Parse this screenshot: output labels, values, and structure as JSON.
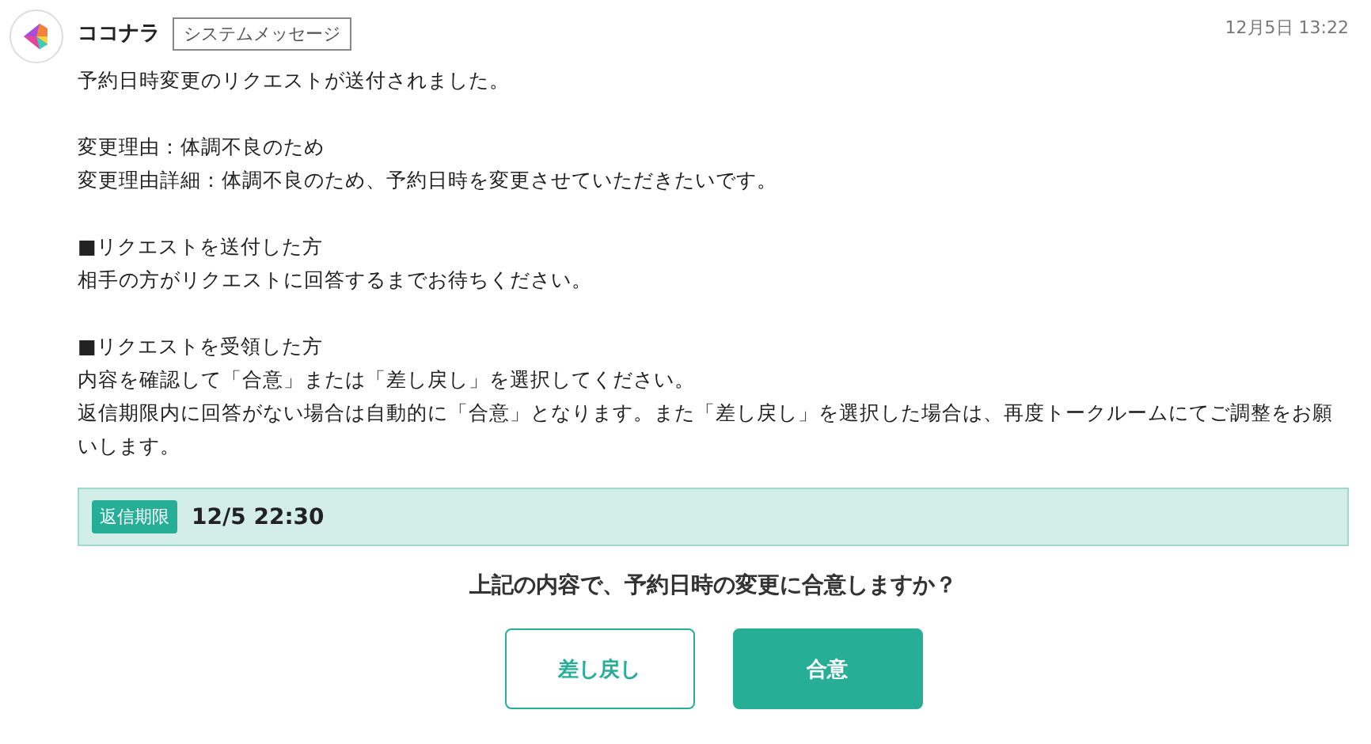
{
  "sender": {
    "name": "ココナラ",
    "tag": "システムメッセージ"
  },
  "timestamp": "12月5日 13:22",
  "paragraphs": [
    [
      "予約日時変更のリクエストが送付されました。"
    ],
    [
      "変更理由：体調不良のため",
      "変更理由詳細：体調不良のため、予約日時を変更させていただきたいです。"
    ],
    [
      "■リクエストを送付した方",
      "相手の方がリクエストに回答するまでお待ちください。"
    ],
    [
      "■リクエストを受領した方",
      "内容を確認して「合意」または「差し戻し」を選択してください。",
      "返信期限内に回答がない場合は自動的に「合意」となります。また「差し戻し」を選択した場合は、再度トークルームにてご調整をお願いします。"
    ]
  ],
  "deadline": {
    "label": "返信期限",
    "value": "12/5 22:30"
  },
  "question": "上記の内容で、予約日時の変更に合意しますか？",
  "buttons": [
    {
      "label": "差し戻し",
      "kind": "secondary"
    },
    {
      "label": "合意",
      "kind": "primary"
    }
  ]
}
